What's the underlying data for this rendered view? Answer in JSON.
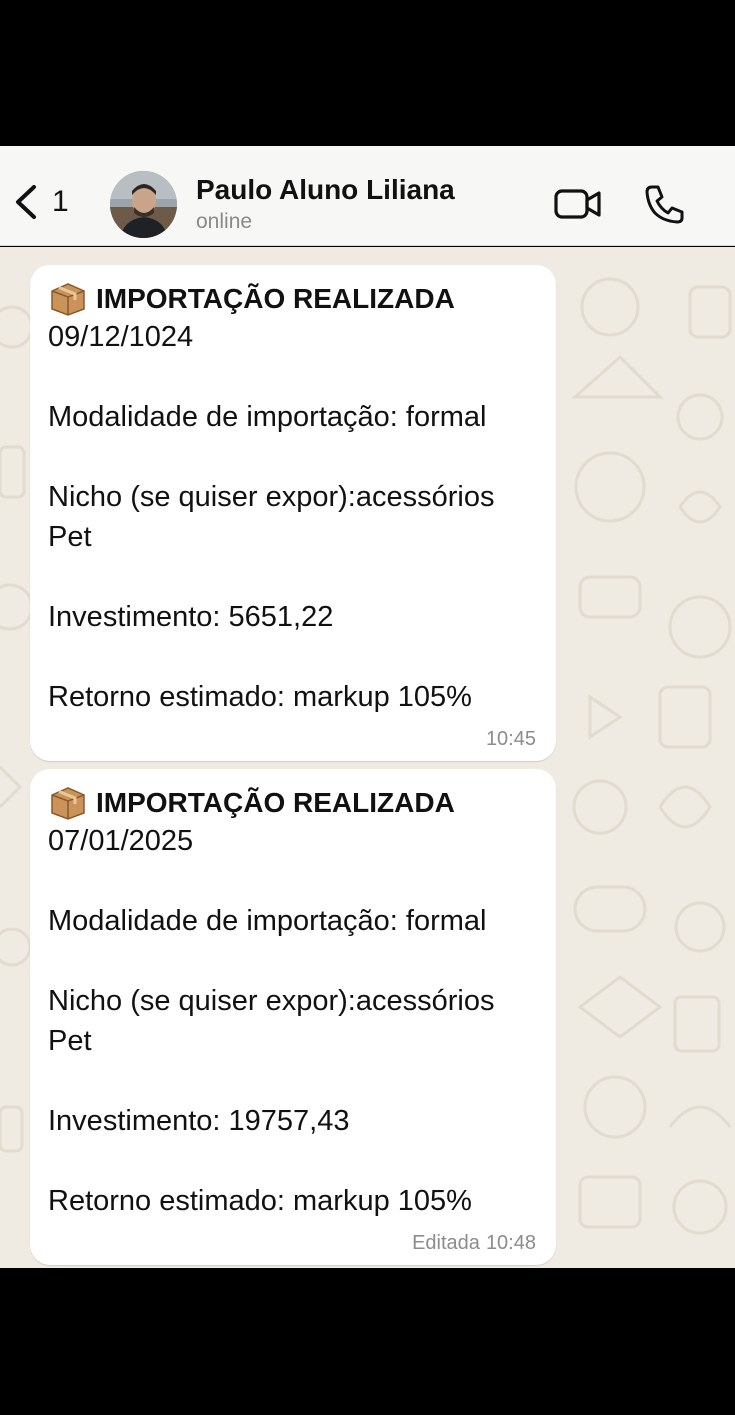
{
  "header": {
    "back_count": "1",
    "contact_name": "Paulo Aluno Liliana",
    "status": "online"
  },
  "messages": [
    {
      "title": "IMPORTAÇÃO REALIZADA",
      "date": "09/12/1024",
      "modalidade": "Modalidade de importação: formal",
      "nicho_line1": "Nicho (se quiser expor):acessórios",
      "nicho_line2": "Pet",
      "investimento": "Investimento: 5651,22",
      "retorno": "Retorno estimado: markup 105%",
      "edited_label": "",
      "time": "10:45"
    },
    {
      "title": "IMPORTAÇÃO REALIZADA",
      "date": "07/01/2025",
      "modalidade": "Modalidade de importação: formal",
      "nicho_line1": "Nicho (se quiser expor):acessórios",
      "nicho_line2": "Pet",
      "investimento": "Investimento: 19757,43",
      "retorno": "Retorno estimado: markup 105%",
      "edited_label": "Editada",
      "time": "10:48"
    }
  ],
  "icons": {
    "back": "chevron-left-icon",
    "video": "video-camera-icon",
    "call": "phone-icon",
    "message_emoji": "package-icon"
  },
  "colors": {
    "chat_background": "#efeae2",
    "bubble": "#ffffff",
    "header": "#f7f7f5",
    "meta_text": "#8c8c8c"
  }
}
